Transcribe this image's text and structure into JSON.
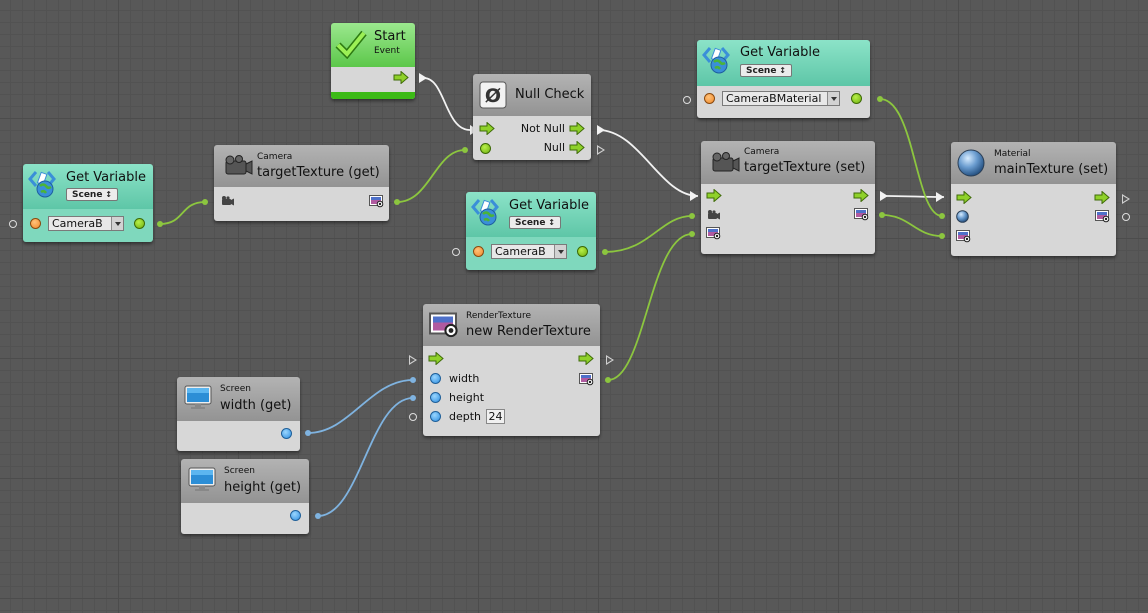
{
  "nodes": {
    "start": {
      "title": "Start",
      "subtitle": "Event"
    },
    "null_check": {
      "title": "Null Check",
      "ports": {
        "not_null": "Not Null",
        "null": "Null"
      }
    },
    "get_var_material": {
      "title": "Get Variable",
      "scope": "Scene",
      "value": "CameraBMaterial"
    },
    "get_var_left": {
      "title": "Get Variable",
      "scope": "Scene",
      "value": "CameraB"
    },
    "get_var_mid": {
      "title": "Get Variable",
      "scope": "Scene",
      "value": "CameraB"
    },
    "camera_get": {
      "category": "Camera",
      "title": "targetTexture (get)"
    },
    "camera_set": {
      "category": "Camera",
      "title": "targetTexture (set)"
    },
    "material_set": {
      "category": "Material",
      "title": "mainTexture (set)"
    },
    "render_texture": {
      "category": "RenderTexture",
      "title": "new RenderTexture",
      "ports": {
        "width": "width",
        "height": "height",
        "depth": "depth"
      },
      "depth_value": "24"
    },
    "screen_width": {
      "category": "Screen",
      "title": "width (get)"
    },
    "screen_height": {
      "category": "Screen",
      "title": "height (get)"
    }
  },
  "icons": {
    "variable": "variable-globe-icon",
    "camera": "camera-icon",
    "material": "sphere-icon",
    "render_texture": "render-texture-icon",
    "screen": "monitor-icon",
    "null": "null-symbol-icon",
    "start": "checkmark-icon",
    "flow": "flow-arrow-icon"
  },
  "colors": {
    "background": "#585858",
    "flow_wire": "#f2f2f2",
    "object_wire": "#8cc63f",
    "number_wire": "#7fb3e0",
    "teal_header": "#6fd4b6",
    "start_green": "#3cba16"
  }
}
